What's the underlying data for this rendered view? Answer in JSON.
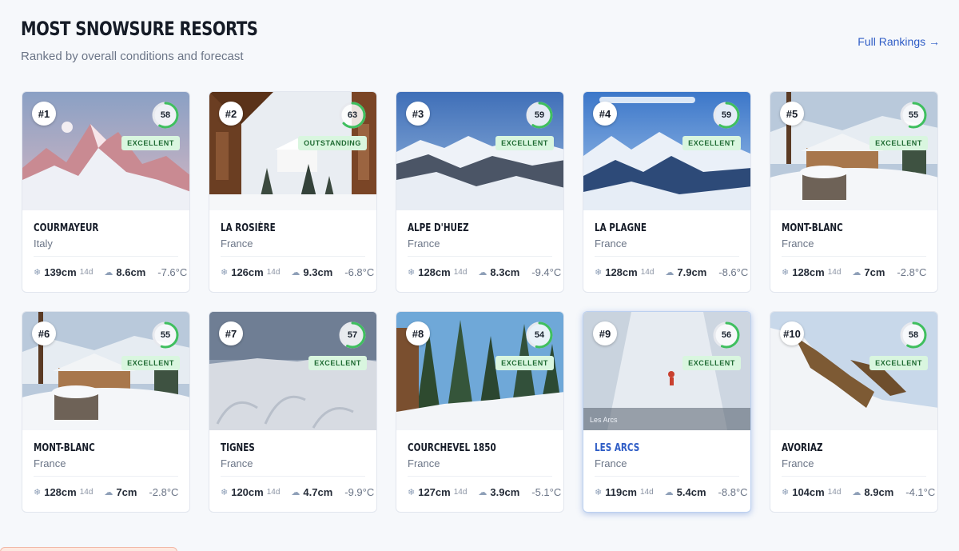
{
  "header": {
    "title": "Most Snowsure Resorts",
    "subtitle": "Ranked by overall conditions and forecast",
    "full_rankings": "Full Rankings →"
  },
  "resorts": [
    {
      "rank": "#1",
      "score": "58",
      "score_pct": 58,
      "rating": "EXCELLENT",
      "name": "Courmayeur",
      "country": "Italy",
      "base": "139cm",
      "period": "14d",
      "new_snow": "8.6cm",
      "temp": "-7.6°C",
      "scene": "sunset-peaks"
    },
    {
      "rank": "#2",
      "score": "63",
      "score_pct": 63,
      "rating": "OUTSTANDING",
      "name": "La Rosière",
      "country": "France",
      "base": "126cm",
      "period": "14d",
      "new_snow": "9.3cm",
      "temp": "-6.8°C",
      "scene": "village-snow"
    },
    {
      "rank": "#3",
      "score": "59",
      "score_pct": 59,
      "rating": "EXCELLENT",
      "name": "Alpe d'Huez",
      "country": "France",
      "base": "128cm",
      "period": "14d",
      "new_snow": "8.3cm",
      "temp": "-9.4°C",
      "scene": "alpine-range"
    },
    {
      "rank": "#4",
      "score": "59",
      "score_pct": 59,
      "rating": "EXCELLENT",
      "name": "La Plagne",
      "country": "France",
      "base": "128cm",
      "period": "14d",
      "new_snow": "7.9cm",
      "temp": "-8.6°C",
      "scene": "blue-range"
    },
    {
      "rank": "#5",
      "score": "55",
      "score_pct": 55,
      "rating": "EXCELLENT",
      "name": "Mont-Blanc",
      "country": "France",
      "base": "128cm",
      "period": "14d",
      "new_snow": "7cm",
      "temp": "-2.8°C",
      "scene": "chalet"
    },
    {
      "rank": "#6",
      "score": "55",
      "score_pct": 55,
      "rating": "EXCELLENT",
      "name": "Mont-Blanc",
      "country": "France",
      "base": "128cm",
      "period": "14d",
      "new_snow": "7cm",
      "temp": "-2.8°C",
      "scene": "chalet"
    },
    {
      "rank": "#7",
      "score": "57",
      "score_pct": 57,
      "rating": "EXCELLENT",
      "name": "Tignes",
      "country": "France",
      "base": "120cm",
      "period": "14d",
      "new_snow": "4.7cm",
      "temp": "-9.9°C",
      "scene": "snowfield"
    },
    {
      "rank": "#8",
      "score": "54",
      "score_pct": 54,
      "rating": "EXCELLENT",
      "name": "Courchevel 1850",
      "country": "France",
      "base": "127cm",
      "period": "14d",
      "new_snow": "3.9cm",
      "temp": "-5.1°C",
      "scene": "forest"
    },
    {
      "rank": "#9",
      "score": "56",
      "score_pct": 56,
      "rating": "EXCELLENT",
      "name": "Les Arcs",
      "country": "France",
      "base": "119cm",
      "period": "14d",
      "new_snow": "5.4cm",
      "temp": "-8.8°C",
      "scene": "skier",
      "caption": "Les Arcs"
    },
    {
      "rank": "#10",
      "score": "58",
      "score_pct": 58,
      "rating": "EXCELLENT",
      "name": "Avoriaz",
      "country": "France",
      "base": "104cm",
      "period": "14d",
      "new_snow": "8.9cm",
      "temp": "-4.1°C",
      "scene": "ridge"
    }
  ],
  "colors": {
    "score_ring": "#3fbf5f",
    "score_track": "#e7e9ee",
    "badge_bg": "#d9f6df",
    "badge_text": "#1f6b33",
    "link": "#2f5dc6"
  },
  "icons": {
    "base_depth": "snowflake-icon",
    "new_snow": "cloud-snow-icon"
  }
}
